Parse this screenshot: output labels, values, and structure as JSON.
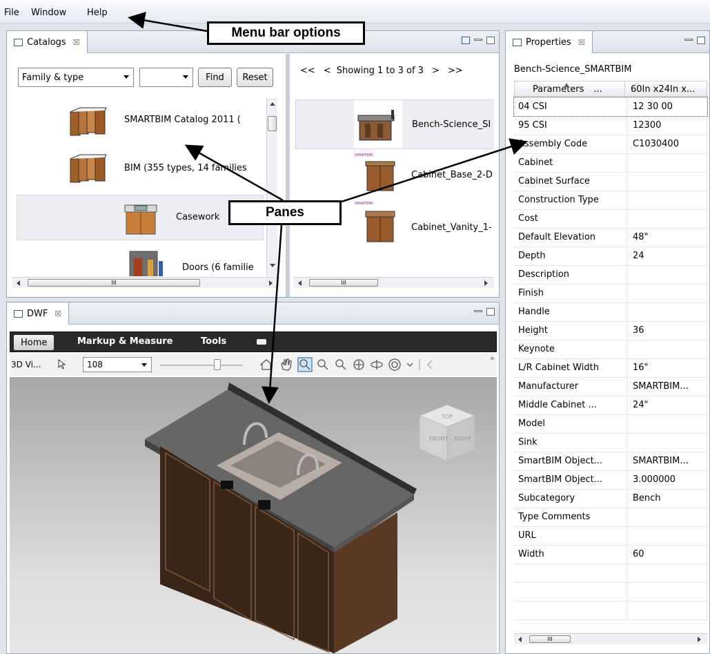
{
  "menu": {
    "file": "File",
    "window": "Window",
    "help": "Help"
  },
  "catalogs": {
    "tab": "Catalogs",
    "close": "☒",
    "filter": {
      "value": "Family & type",
      "second": "",
      "find": "Find",
      "reset": "Reset"
    },
    "items": [
      "SMARTBIM Catalog 2011  (",
      "BIM  (355 types, 14 families",
      "Casework",
      "Doors  (6 familie"
    ],
    "results": {
      "first": "<<",
      "prev": "<",
      "showing": "Showing 1 to 3 of 3",
      "next": ">",
      "last": ">>"
    },
    "result_items": [
      "Bench-Science_SI",
      "Cabinet_Base_2-D",
      "Cabinet_Vanity_1-"
    ],
    "brand_tag": "SMARTBIM",
    "scroll_grip": "III"
  },
  "properties": {
    "tab": "Properties",
    "close": "☒",
    "object": "Bench-Science_SMARTBIM",
    "header": {
      "param": "Parameters",
      "ellipsis": "...",
      "value": "60In x24In x..."
    },
    "rows": [
      [
        "04 CSI",
        "12 30 00"
      ],
      [
        "95 CSI",
        "12300"
      ],
      [
        "Assembly Code",
        "C1030400"
      ],
      [
        "Cabinet",
        ""
      ],
      [
        "Cabinet Surface",
        ""
      ],
      [
        "Construction Type",
        ""
      ],
      [
        "Cost",
        ""
      ],
      [
        "Default Elevation",
        "48\""
      ],
      [
        "Depth",
        "24"
      ],
      [
        "Description",
        ""
      ],
      [
        "Finish",
        ""
      ],
      [
        "Handle",
        ""
      ],
      [
        "Height",
        "36"
      ],
      [
        "Keynote",
        ""
      ],
      [
        "L/R Cabinet Width",
        "16\""
      ],
      [
        "Manufacturer",
        "SMARTBIM..."
      ],
      [
        "Middle Cabinet ...",
        "24\""
      ],
      [
        "Model",
        ""
      ],
      [
        "Sink",
        ""
      ],
      [
        "SmartBIM Object...",
        "SMARTBIM..."
      ],
      [
        "SmartBIM Object...",
        "3.000000"
      ],
      [
        "Subcategory",
        "Bench"
      ],
      [
        "Type Comments",
        ""
      ],
      [
        "URL",
        ""
      ],
      [
        "Width",
        "60"
      ],
      [
        "",
        ""
      ],
      [
        "",
        ""
      ],
      [
        "",
        ""
      ]
    ],
    "scroll_grip": "III"
  },
  "dwf": {
    "tab": "DWF",
    "close": "☒",
    "ribbon": {
      "home": "Home",
      "markup": "Markup & Measure",
      "tools": "Tools"
    },
    "toolbar": {
      "view": "3D Vi...",
      "zoom": "108",
      "more": "»"
    },
    "cube": {
      "top": "TOP",
      "front": "FRONT",
      "right": "RIGHT"
    }
  },
  "callouts": {
    "menu_bar": "Menu bar options",
    "panes": "Panes"
  },
  "colors": {
    "chrome": "#dfe3ea",
    "selection": "#e9ecef",
    "viewport_top": "#aaaaaa",
    "viewport_bottom": "#e2e2e2",
    "cabinet": "#3a2618",
    "counter": "#606060"
  }
}
